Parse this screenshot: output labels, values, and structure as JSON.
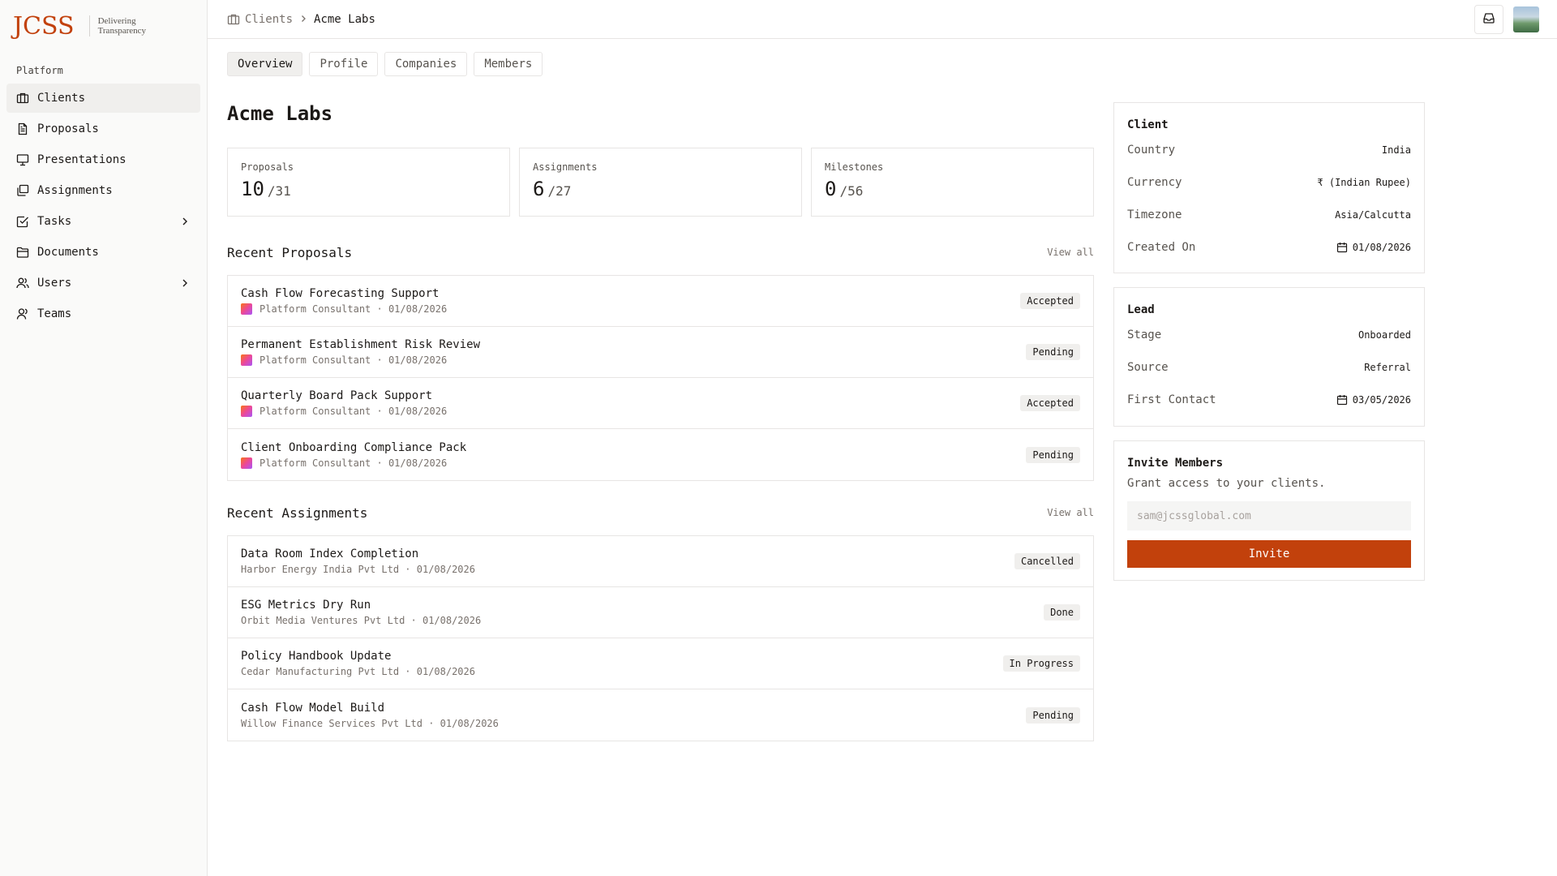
{
  "brand": {
    "logo": "JCSS",
    "tagline_line1": "Delivering",
    "tagline_line2": "Transparency",
    "accent": "#c2410c"
  },
  "sidebar": {
    "section_label": "Platform",
    "items": [
      {
        "label": "Clients",
        "icon": "building-icon",
        "active": true
      },
      {
        "label": "Proposals",
        "icon": "document-icon"
      },
      {
        "label": "Presentations",
        "icon": "presentation-icon"
      },
      {
        "label": "Assignments",
        "icon": "stack-icon"
      },
      {
        "label": "Tasks",
        "icon": "checkbox-icon",
        "has_children": true
      },
      {
        "label": "Documents",
        "icon": "folder-icon"
      },
      {
        "label": "Users",
        "icon": "users-icon",
        "has_children": true
      },
      {
        "label": "Teams",
        "icon": "team-icon"
      }
    ]
  },
  "topbar": {
    "breadcrumb_root": "Clients",
    "breadcrumb_current": "Acme Labs"
  },
  "tabs": [
    "Overview",
    "Profile",
    "Companies",
    "Members"
  ],
  "page": {
    "title": "Acme Labs"
  },
  "stats": [
    {
      "label": "Proposals",
      "value": "10",
      "total": "/31"
    },
    {
      "label": "Assignments",
      "value": "6",
      "total": "/27"
    },
    {
      "label": "Milestones",
      "value": "0",
      "total": "/56"
    }
  ],
  "recent_proposals": {
    "title": "Recent Proposals",
    "view_all": "View all",
    "items": [
      {
        "title": "Cash Flow Forecasting Support",
        "meta": "Platform Consultant · 01/08/2026",
        "status": "Accepted"
      },
      {
        "title": "Permanent Establishment Risk Review",
        "meta": "Platform Consultant · 01/08/2026",
        "status": "Pending"
      },
      {
        "title": "Quarterly Board Pack Support",
        "meta": "Platform Consultant · 01/08/2026",
        "status": "Accepted"
      },
      {
        "title": "Client Onboarding Compliance Pack",
        "meta": "Platform Consultant · 01/08/2026",
        "status": "Pending"
      }
    ]
  },
  "recent_assignments": {
    "title": "Recent Assignments",
    "view_all": "View all",
    "items": [
      {
        "title": "Data Room Index Completion",
        "meta": "Harbor Energy India Pvt Ltd · 01/08/2026",
        "status": "Cancelled"
      },
      {
        "title": "ESG Metrics Dry Run",
        "meta": "Orbit Media Ventures Pvt Ltd · 01/08/2026",
        "status": "Done"
      },
      {
        "title": "Policy Handbook Update",
        "meta": "Cedar Manufacturing Pvt Ltd · 01/08/2026",
        "status": "In Progress"
      },
      {
        "title": "Cash Flow Model Build",
        "meta": "Willow Finance Services Pvt Ltd · 01/08/2026",
        "status": "Pending"
      }
    ]
  },
  "client_panel": {
    "title": "Client",
    "rows": [
      {
        "key": "Country",
        "value": "India"
      },
      {
        "key": "Currency",
        "value": "₹ (Indian Rupee)"
      },
      {
        "key": "Timezone",
        "value": "Asia/Calcutta"
      },
      {
        "key": "Created On",
        "value": "01/08/2026",
        "icon": "calendar-icon"
      }
    ]
  },
  "lead_panel": {
    "title": "Lead",
    "rows": [
      {
        "key": "Stage",
        "value": "Onboarded"
      },
      {
        "key": "Source",
        "value": "Referral"
      },
      {
        "key": "First Contact",
        "value": "03/05/2026",
        "icon": "calendar-icon"
      }
    ]
  },
  "invite_panel": {
    "title": "Invite Members",
    "subtitle": "Grant access to your clients.",
    "placeholder": "sam@jcssglobal.com",
    "button": "Invite"
  }
}
